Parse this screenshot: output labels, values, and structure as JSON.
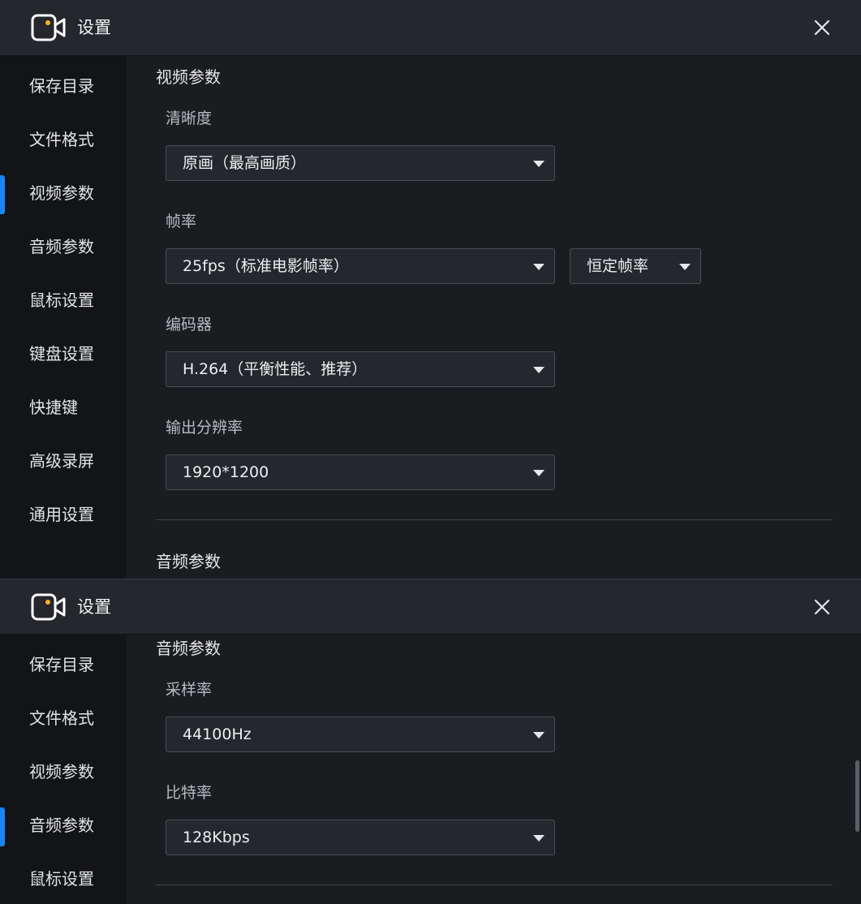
{
  "colors": {
    "accent": "#1a83ff",
    "icon_dot": "#ffb020"
  },
  "panel_a": {
    "title": "设置",
    "nav": [
      "保存目录",
      "文件格式",
      "视频参数",
      "音频参数",
      "鼠标设置",
      "键盘设置",
      "快捷键",
      "高级录屏",
      "通用设置"
    ],
    "active_nav": "视频参数",
    "video_section": {
      "title": "视频参数",
      "quality_label": "清晰度",
      "quality_value": "原画（最高画质）",
      "fps_label": "帧率",
      "fps_value": "25fps（标准电影帧率）",
      "fps_mode_value": "恒定帧率",
      "encoder_label": "编码器",
      "encoder_value": "H.264（平衡性能、推荐）",
      "resolution_label": "输出分辨率",
      "resolution_value": "1920*1200"
    },
    "next_section_title": "音频参数"
  },
  "panel_b": {
    "title": "设置",
    "nav": [
      "保存目录",
      "文件格式",
      "视频参数",
      "音频参数",
      "鼠标设置"
    ],
    "active_nav": "音频参数",
    "audio_section": {
      "title": "音频参数",
      "sample_rate_label": "采样率",
      "sample_rate_value": "44100Hz",
      "bitrate_label": "比特率",
      "bitrate_value": "128Kbps"
    }
  }
}
